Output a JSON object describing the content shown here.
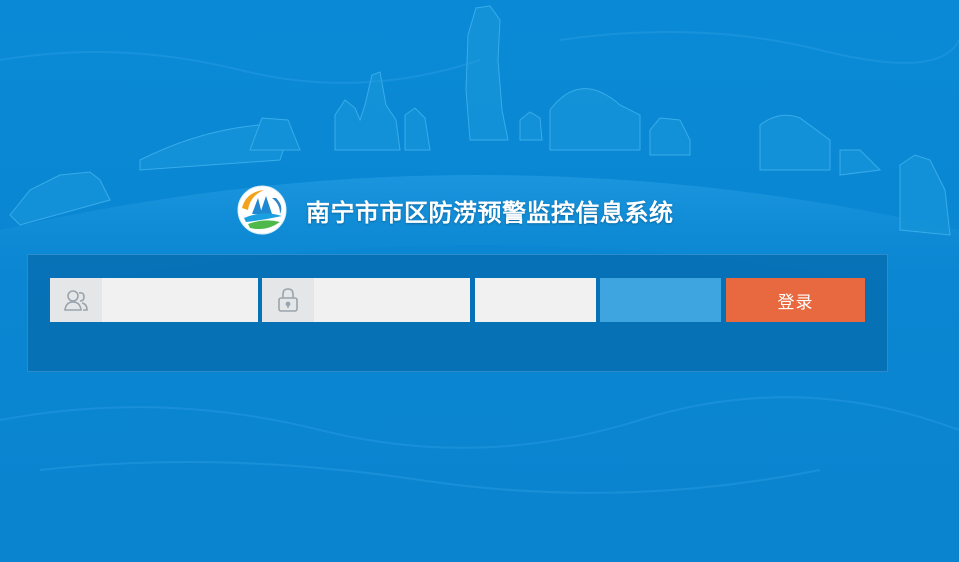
{
  "app": {
    "title": "南宁市市区防涝预警监控信息系统"
  },
  "login": {
    "username": {
      "value": "",
      "placeholder": "",
      "icon": "user-icon"
    },
    "password": {
      "value": "",
      "placeholder": "",
      "icon": "lock-icon"
    },
    "captcha": {
      "value": "",
      "placeholder": ""
    },
    "submit_label": "登录"
  },
  "colors": {
    "background": "#0a88d4",
    "panel": "#0a6eb0",
    "input_bg": "#f1f1f1",
    "captcha_bg": "#3ea5e0",
    "login_button": "#e8693f",
    "title_text": "#ffffff"
  }
}
